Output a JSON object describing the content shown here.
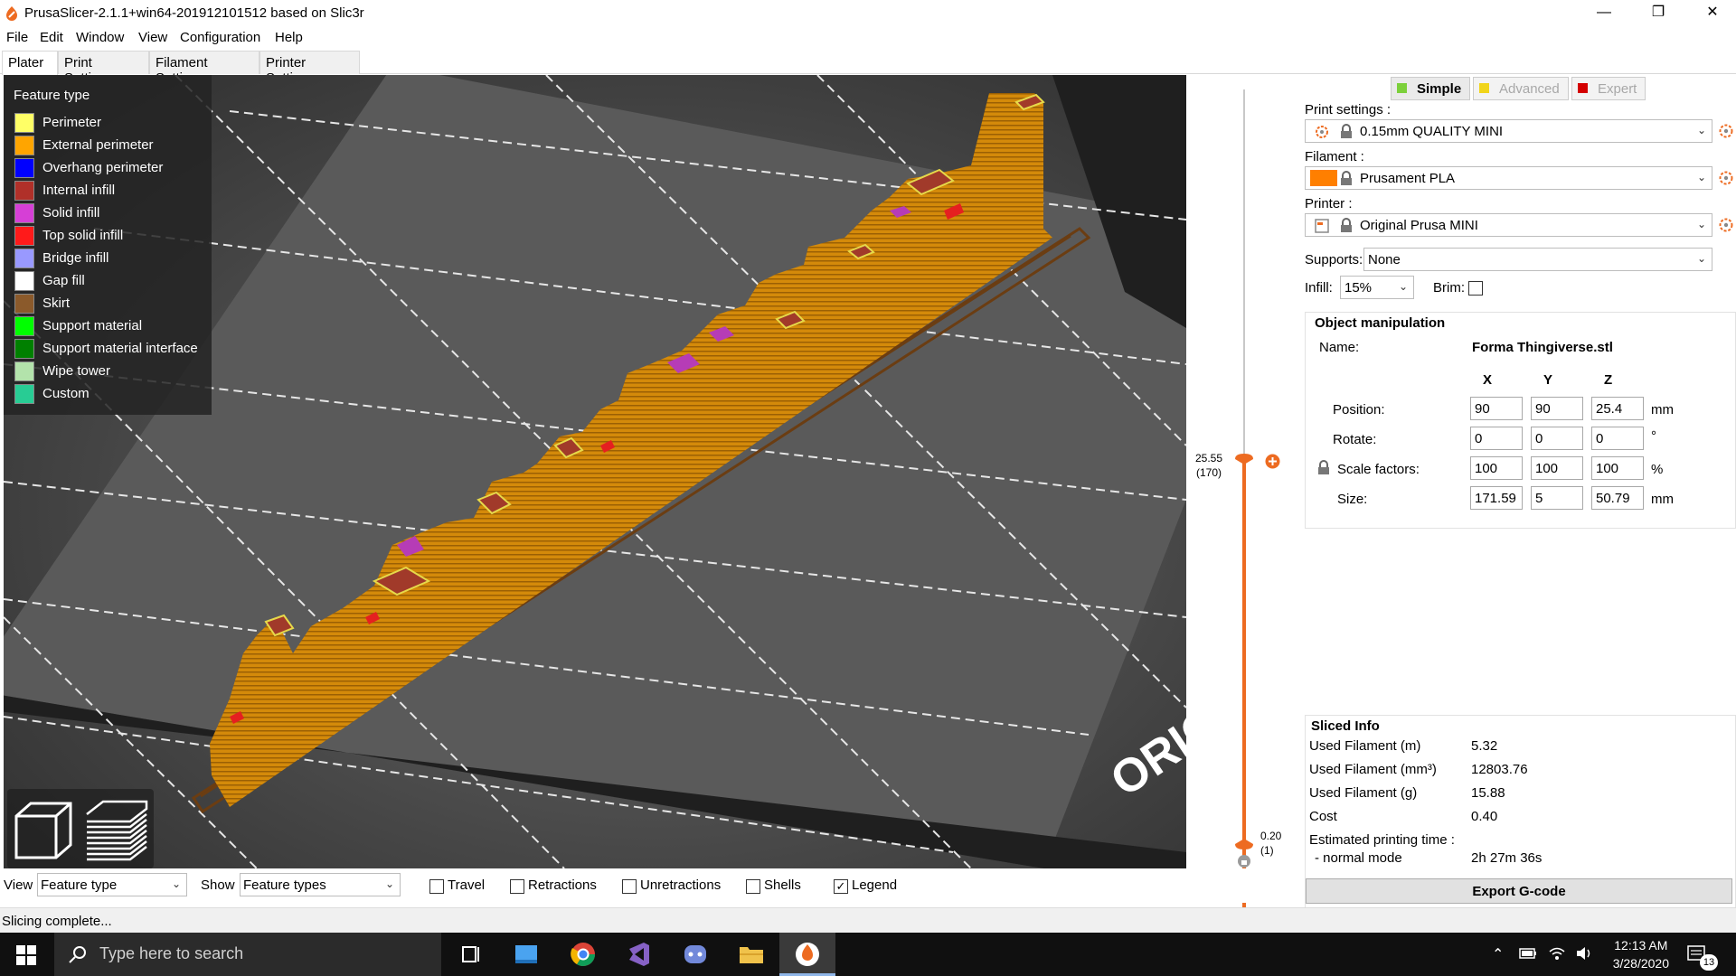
{
  "window": {
    "title": "PrusaSlicer-2.1.1+win64-201912101512 based on Slic3r",
    "minimize_icon": "minimize-icon",
    "maximize_icon": "maximize-icon",
    "close_icon": "close-icon"
  },
  "menu": [
    "File",
    "Edit",
    "Window",
    "View",
    "Configuration",
    "Help"
  ],
  "tabs": [
    "Plater",
    "Print Settings",
    "Filament Settings",
    "Printer Settings"
  ],
  "legend": {
    "title": "Feature type",
    "items": [
      {
        "label": "Perimeter",
        "color": "#ffff66"
      },
      {
        "label": "External perimeter",
        "color": "#ffa500"
      },
      {
        "label": "Overhang perimeter",
        "color": "#0000ff"
      },
      {
        "label": "Internal infill",
        "color": "#b03029"
      },
      {
        "label": "Solid infill",
        "color": "#d63fd6"
      },
      {
        "label": "Top solid infill",
        "color": "#ff1a1a"
      },
      {
        "label": "Bridge infill",
        "color": "#9999ff"
      },
      {
        "label": "Gap fill",
        "color": "#ffffff"
      },
      {
        "label": "Skirt",
        "color": "#8b5a2b"
      },
      {
        "label": "Support material",
        "color": "#00ff00"
      },
      {
        "label": "Support material interface",
        "color": "#008000"
      },
      {
        "label": "Wipe tower",
        "color": "#b3e3ab"
      },
      {
        "label": "Custom",
        "color": "#28cc94"
      }
    ]
  },
  "bed_text": "ORIGI",
  "layer_slider": {
    "top_height": "25.55",
    "top_layer": "(170)",
    "bottom_height": "0.20",
    "bottom_layer": "(1)",
    "accent_color": "#ed6b21"
  },
  "mode": {
    "simple": "Simple",
    "advanced": "Advanced",
    "expert": "Expert",
    "simple_color": "#7cd03b",
    "advanced_color": "#f1d51b",
    "expert_color": "#d40000"
  },
  "print_settings": {
    "label": "Print settings :",
    "value": "0.15mm QUALITY MINI"
  },
  "filament": {
    "label": "Filament :",
    "value": "Prusament PLA",
    "swatch": "#ff7f00"
  },
  "printer": {
    "label": "Printer :",
    "value": "Original Prusa MINI"
  },
  "supports": {
    "label": "Supports:",
    "value": "None"
  },
  "infill": {
    "label": "Infill:",
    "value": "15%"
  },
  "brim": {
    "label": "Brim:"
  },
  "object_manipulation": {
    "title": "Object manipulation",
    "name_label": "Name:",
    "name_value": "Forma Thingiverse.stl",
    "x": "X",
    "y": "Y",
    "z": "Z",
    "position": {
      "label": "Position:",
      "x": "90",
      "y": "90",
      "z": "25.4",
      "unit": "mm"
    },
    "rotate": {
      "label": "Rotate:",
      "x": "0",
      "y": "0",
      "z": "0",
      "unit": "°"
    },
    "scale": {
      "label": "Scale factors:",
      "x": "100",
      "y": "100",
      "z": "100",
      "unit": "%"
    },
    "size": {
      "label": "Size:",
      "x": "171.59",
      "y": "5",
      "z": "50.79",
      "unit": "mm"
    }
  },
  "sliced_info": {
    "title": "Sliced Info",
    "rows": [
      {
        "label": "Used Filament (m)",
        "value": "5.32"
      },
      {
        "label": "Used Filament (mm³)",
        "value": "12803.76"
      },
      {
        "label": "Used Filament (g)",
        "value": "15.88"
      },
      {
        "label": "Cost",
        "value": "0.40"
      }
    ],
    "time_label": "Estimated printing time :",
    "mode_label": "- normal mode",
    "mode_value": "2h 27m 36s"
  },
  "export_button": "Export G-code",
  "bottom": {
    "view_label": "View",
    "view_value": "Feature type",
    "show_label": "Show",
    "show_value": "Feature types",
    "checks": [
      {
        "label": "Travel",
        "checked": false
      },
      {
        "label": "Retractions",
        "checked": false
      },
      {
        "label": "Unretractions",
        "checked": false
      },
      {
        "label": "Shells",
        "checked": false
      },
      {
        "label": "Legend",
        "checked": true
      }
    ]
  },
  "status": "Slicing complete...",
  "taskbar": {
    "search_placeholder": "Type here to search",
    "time": "12:13 AM",
    "date": "3/28/2020",
    "notifications": "13"
  }
}
